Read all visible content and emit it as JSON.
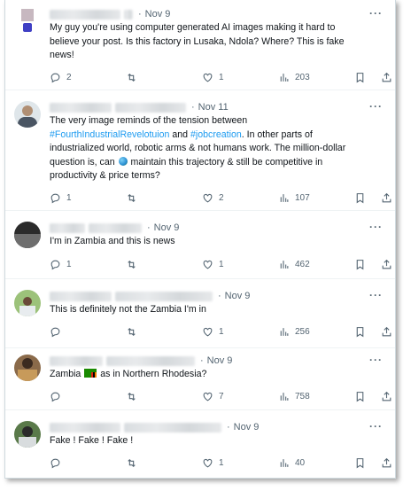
{
  "tweets": [
    {
      "time": "Nov 9",
      "lines": [
        "My guy you're using computer generated AI images making it hard to",
        "believe your post. Is this factory in Lusaka, Ndola? Where? This is fake",
        "news!"
      ],
      "replies": "2",
      "retweets": "",
      "likes": "1",
      "views": "203"
    },
    {
      "time": "Nov 11",
      "line1": "The very image reminds of the tension between",
      "hashtag1": "#FourthIndustrialRevelotuion",
      "and": " and ",
      "hashtag2": "#jobcreation",
      "line2_rest": ". In other parts of",
      "line3": "industrialized world, robotic arms & not humans work. The million-dollar",
      "line4_a": "question is, can",
      "line4_b": "maintain this trajectory & still be competitive in",
      "line5": "productivity & price terms?",
      "replies": "1",
      "retweets": "",
      "likes": "2",
      "views": "107"
    },
    {
      "time": "Nov 9",
      "lines": [
        "I'm in Zambia and this is news"
      ],
      "replies": "1",
      "retweets": "",
      "likes": "1",
      "views": "462"
    },
    {
      "time": "Nov 9",
      "lines": [
        "This is definitely not the Zambia I'm in"
      ],
      "replies": "",
      "retweets": "",
      "likes": "1",
      "views": "256"
    },
    {
      "time": "Nov 9",
      "text_a": "Zambia",
      "text_b": "as in Northern Rhodesia?",
      "replies": "",
      "retweets": "",
      "likes": "7",
      "views": "758"
    },
    {
      "time": "Nov 9",
      "lines": [
        "Fake ! Fake ! Fake !"
      ],
      "replies": "",
      "retweets": "",
      "likes": "1",
      "views": "40"
    }
  ],
  "icons": {
    "reply": "reply-icon",
    "retweet": "retweet-icon",
    "like": "heart-icon",
    "views": "views-icon",
    "bookmark": "bookmark-icon",
    "share": "share-icon",
    "more": "more-icon"
  },
  "more_label": "···",
  "colors": {
    "text": "#0f1419",
    "muted": "#536471",
    "link": "#1d9bf0",
    "border": "#cfd9de"
  }
}
